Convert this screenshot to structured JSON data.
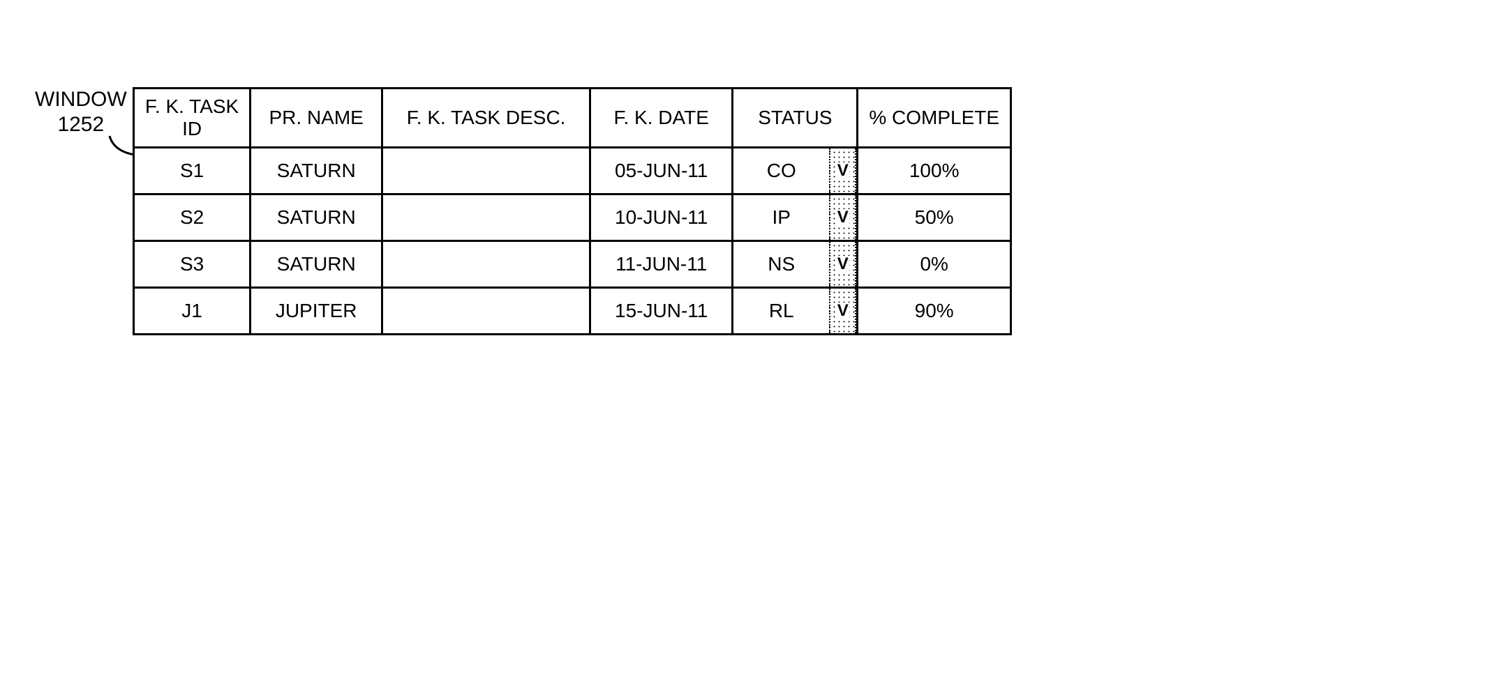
{
  "label": {
    "line1": "WINDOW",
    "line2": "1252"
  },
  "headers": {
    "task_id": "F. K. TASK ID",
    "pr_name": "PR. NAME",
    "task_desc": "F. K. TASK DESC.",
    "date": "F. K. DATE",
    "status": "STATUS",
    "pct": "% COMPLETE"
  },
  "drop_glyph": "V",
  "rows": [
    {
      "task_id": "S1",
      "pr_name": "SATURN",
      "task_desc": "",
      "date": "05-JUN-11",
      "status": "CO",
      "pct": "100%"
    },
    {
      "task_id": "S2",
      "pr_name": "SATURN",
      "task_desc": "",
      "date": "10-JUN-11",
      "status": "IP",
      "pct": "50%"
    },
    {
      "task_id": "S3",
      "pr_name": "SATURN",
      "task_desc": "",
      "date": "11-JUN-11",
      "status": "NS",
      "pct": "0%"
    },
    {
      "task_id": "J1",
      "pr_name": "JUPITER",
      "task_desc": "",
      "date": "15-JUN-11",
      "status": "RL",
      "pct": "90%"
    }
  ]
}
